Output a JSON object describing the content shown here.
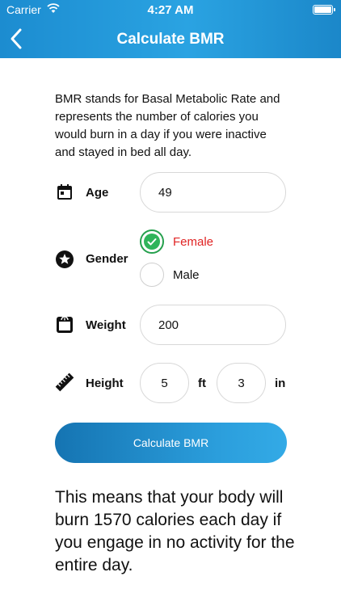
{
  "status_bar": {
    "carrier": "Carrier",
    "time": "4:27 AM"
  },
  "nav": {
    "title": "Calculate BMR",
    "back_icon": "chevron-left-icon"
  },
  "intro": "BMR stands for Basal Metabolic Rate and represents the number of calories you would burn in a day if you were inactive and stayed in bed all day.",
  "form": {
    "age": {
      "label": "Age",
      "value": "49",
      "icon": "calendar-icon"
    },
    "gender": {
      "label": "Gender",
      "icon": "star-icon",
      "options": [
        {
          "label": "Female",
          "selected": true,
          "color": "#e02424"
        },
        {
          "label": "Male",
          "selected": false,
          "color": "#111111"
        }
      ]
    },
    "weight": {
      "label": "Weight",
      "value": "200",
      "icon": "scale-icon"
    },
    "height": {
      "label": "Height",
      "icon": "ruler-icon",
      "feet": "5",
      "feet_unit": "ft",
      "inches": "3",
      "inches_unit": "in"
    }
  },
  "button": {
    "label": "Calculate BMR"
  },
  "result": "This means that your body will burn 1570 calories each day if you engage in no activity for the entire day.",
  "colors": {
    "header": "#1c8cd0",
    "selected": "#2fb45a",
    "female_text": "#e02424"
  }
}
